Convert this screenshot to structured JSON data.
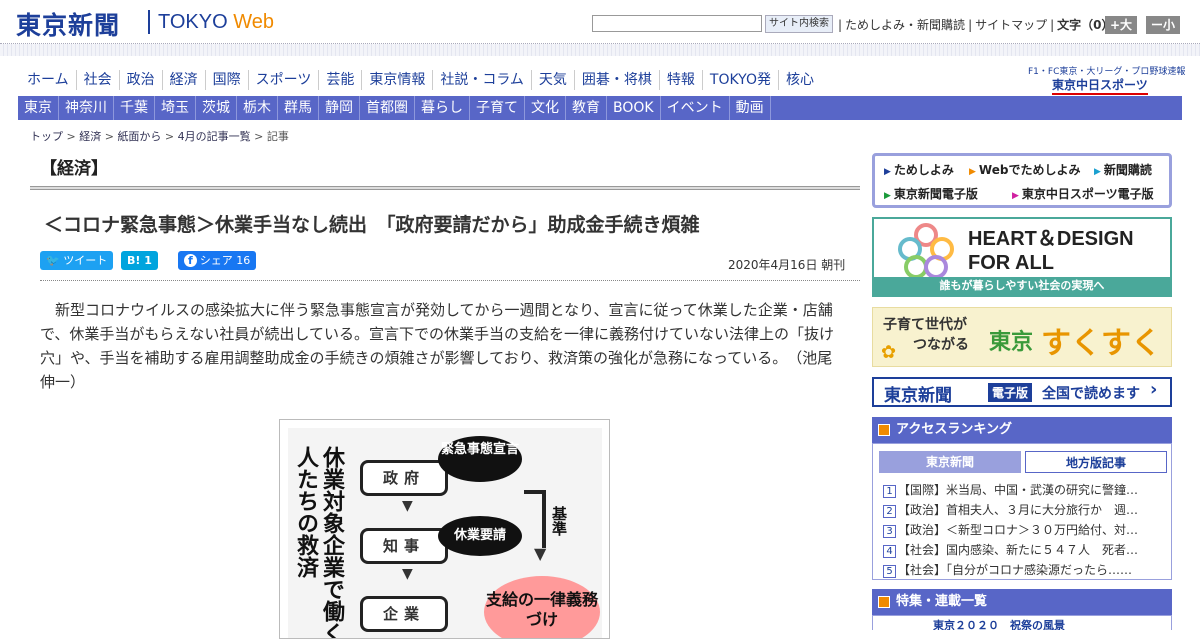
{
  "header": {
    "logo_jp": "東京新聞",
    "logo_en": "TOKYO ",
    "logo_web": "Web",
    "search_placeholder": "",
    "search_button": "サイト内検索",
    "links": [
      "ためしよみ・新聞購読",
      "サイトマップ",
      "文字（0）"
    ],
    "font_plus": "+大",
    "font_minus": "ー小"
  },
  "nav_main": [
    "ホーム",
    "社会",
    "政治",
    "経済",
    "国際",
    "スポーツ",
    "芸能",
    "東京情報",
    "社説・コラム",
    "天気",
    "囲碁・将棋",
    "特報",
    "TOKYO発",
    "核心"
  ],
  "chunichi": {
    "top": "F1・FC東京・大リーグ・プロ野球速報",
    "logo": "東京中日スポーツ"
  },
  "nav_sub": [
    "東京",
    "神奈川",
    "千葉",
    "埼玉",
    "茨城",
    "栃木",
    "群馬",
    "静岡",
    "首都圏",
    "暮らし",
    "子育て",
    "文化",
    "教育",
    "BOOK",
    "イベント",
    "動画"
  ],
  "breadcrumb": [
    "トップ",
    "経済",
    "紙面から",
    "4月の記事一覧",
    "記事"
  ],
  "breadcrumb_sep": " > ",
  "section": "【経済】",
  "article": {
    "headline": "＜コロナ緊急事態＞休業手当なし続出　「政府要請だから」助成金手続き煩雑",
    "tweet": "ツイート",
    "hatena": "B! 1",
    "share": "シェア 16",
    "date": "2020年4月16日 朝刊",
    "body": "新型コロナウイルスの感染拡大に伴う緊急事態宣言が発効してから一週間となり、宣言に従って休業した企業・店舗で、休業手当がもらえない社員が続出している。宣言下での休業手当の支給を一律に義務付けていない法律上の「抜け穴」や、手当を補助する雇用調整助成金の手続きの煩雑さが影響しており、救済策の強化が急務になっている。　（池尾伸一）"
  },
  "figure": {
    "vtitle": "休業対象企業で働く人たちの救済",
    "boxes": [
      "政府",
      "知事",
      "企業"
    ],
    "bubble1": "緊急事態宣言",
    "bubble2": "休業要請",
    "arrow_label": "基準",
    "burst": "支給の一律義務づけ"
  },
  "sidebar": {
    "links": [
      "ためしよみ",
      "Webでためしよみ",
      "新聞購読",
      "東京新聞電子版",
      "東京中日スポーツ電子版"
    ],
    "hd_line1": "HEART＆DESIGN",
    "hd_line2": "FOR ALL",
    "hd_foot": "誰もが暮らしやすい社会の実現へ",
    "sk_text1": "子育て世代が",
    "sk_text2": "つながる",
    "sk_logo1": "東京",
    "sk_logo2": "すくすく",
    "den_logo": "東京新聞",
    "den_badge": "電子版",
    "den_text": "全国で読めます",
    "ranking_title": "アクセスランキング",
    "tab_on": "東京新聞",
    "tab_off": "地方版記事",
    "ranking": [
      "【国際】米当局、中国・武漢の研究に警鐘…",
      "【政治】首相夫人、３月に大分旅行か　週…",
      "【政治】＜新型コロナ＞３０万円給付、対…",
      "【社会】国内感染、新たに５４７人　死者…",
      "【社会】「自分がコロナ感染源だったら……"
    ],
    "feature_title": "特集・連載一覧",
    "feature_item": "東京２０２０　祝祭の風景"
  },
  "colors": {
    "brand": "#1d3f9a",
    "nav": "#5866c7",
    "accent": "#f08a00"
  }
}
